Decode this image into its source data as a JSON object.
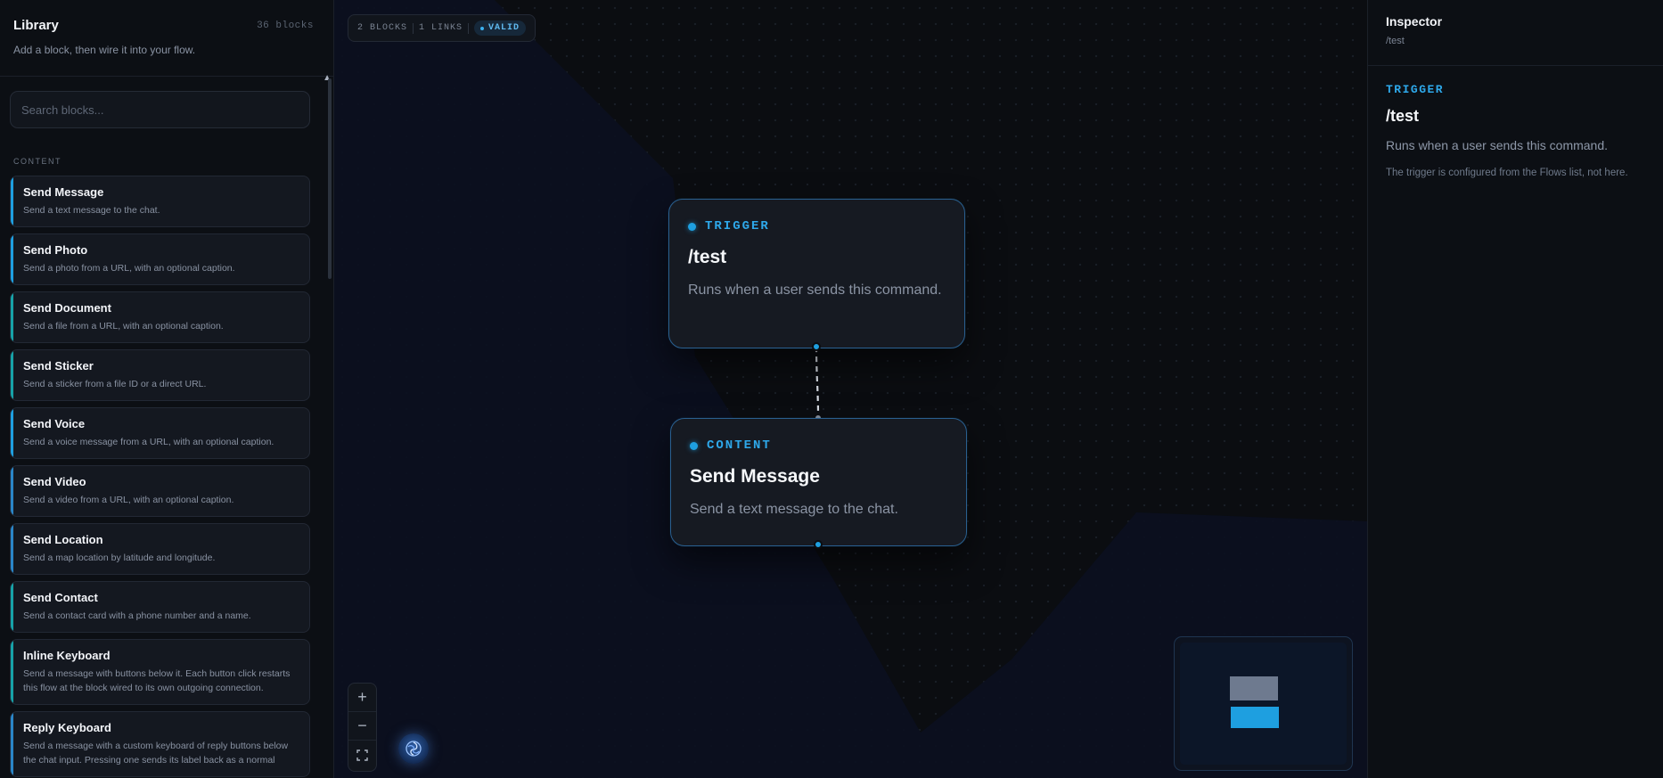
{
  "library": {
    "title": "Library",
    "count": "36 blocks",
    "subtitle": "Add a block, then wire it into your flow.",
    "search_placeholder": "Search blocks...",
    "section": "CONTENT",
    "blocks": [
      {
        "name": "Send Message",
        "desc": "Send a text message to the chat."
      },
      {
        "name": "Send Photo",
        "desc": "Send a photo from a URL, with an optional caption."
      },
      {
        "name": "Send Document",
        "desc": "Send a file from a URL, with an optional caption."
      },
      {
        "name": "Send Sticker",
        "desc": "Send a sticker from a file ID or a direct URL."
      },
      {
        "name": "Send Voice",
        "desc": "Send a voice message from a URL, with an optional caption."
      },
      {
        "name": "Send Video",
        "desc": "Send a video from a URL, with an optional caption."
      },
      {
        "name": "Send Location",
        "desc": "Send a map location by latitude and longitude."
      },
      {
        "name": "Send Contact",
        "desc": "Send a contact card with a phone number and a name."
      },
      {
        "name": "Inline Keyboard",
        "desc": "Send a message with buttons below it. Each button click restarts this flow at the block wired to its own outgoing connection."
      },
      {
        "name": "Reply Keyboard",
        "desc": "Send a message with a custom keyboard of reply buttons below the chat input. Pressing one sends its label back as a normal"
      }
    ]
  },
  "canvas": {
    "stats": {
      "blocks": "2 BLOCKS",
      "links": "1 LINKS",
      "status": "VALID"
    },
    "nodes": {
      "trigger": {
        "kind": "TRIGGER",
        "title": "/test",
        "desc": "Runs when a user sends this command."
      },
      "content": {
        "kind": "CONTENT",
        "title": "Send Message",
        "desc": "Send a text message to the chat."
      }
    },
    "zoom": {
      "in": "+",
      "out": "−"
    }
  },
  "inspector": {
    "title": "Inspector",
    "subtitle": "/test",
    "kind": "TRIGGER",
    "name": "/test",
    "desc": "Runs when a user sends this command.",
    "note": "The trigger is configured from the Flows list, not here."
  },
  "colors": {
    "accent": "#1e9fe0",
    "background": "#0b0d11",
    "panel": "#0c0f14"
  }
}
